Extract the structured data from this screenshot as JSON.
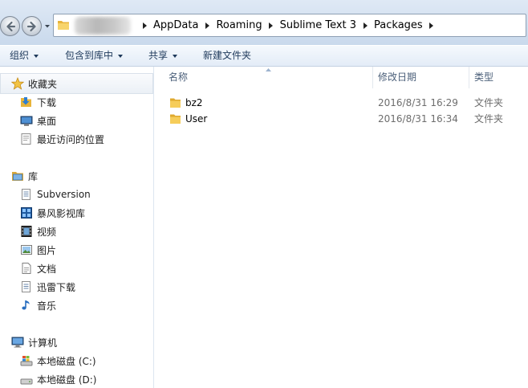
{
  "address_bar": {
    "crumbs": [
      "AppData",
      "Roaming",
      "Sublime Text 3",
      "Packages"
    ]
  },
  "toolbar": {
    "organize": "组织",
    "include_in_library": "包含到库中",
    "share": "共享",
    "new_folder": "新建文件夹"
  },
  "nav": {
    "favorites": {
      "label": "收藏夹",
      "items": [
        "下载",
        "桌面",
        "最近访问的位置"
      ]
    },
    "libraries": {
      "label": "库",
      "items": [
        "Subversion",
        "暴风影视库",
        "视频",
        "图片",
        "文档",
        "迅雷下载",
        "音乐"
      ]
    },
    "computer": {
      "label": "计算机",
      "items": [
        "本地磁盘 (C:)",
        "本地磁盘 (D:)"
      ]
    }
  },
  "columns": {
    "name": "名称",
    "date": "修改日期",
    "type": "类型"
  },
  "files": [
    {
      "name": "bz2",
      "date": "2016/8/31 16:29",
      "type": "文件夹"
    },
    {
      "name": "User",
      "date": "2016/8/31 16:34",
      "type": "文件夹"
    }
  ],
  "colors": {
    "toolbar_text": "#1e395b",
    "folder_yellow": "#f3c34d",
    "header_text": "#4c607a"
  }
}
